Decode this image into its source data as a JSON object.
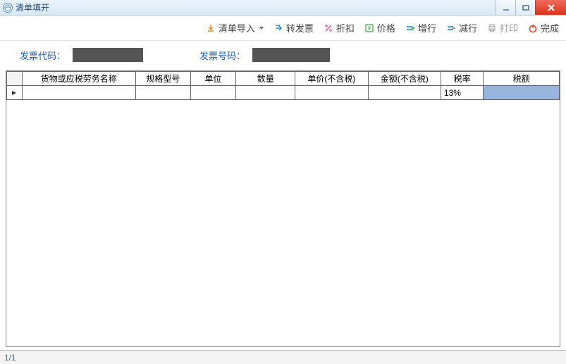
{
  "window": {
    "title": "清单填开"
  },
  "toolbar": {
    "import": "清单导入",
    "to_invoice": "转发票",
    "discount": "折扣",
    "price": "价格",
    "add_row": "增行",
    "del_row": "减行",
    "print": "打印",
    "finish": "完成"
  },
  "info": {
    "code_label": "发票代码：",
    "num_label": "发票号码："
  },
  "grid": {
    "headers": {
      "name": "货物或应税劳务名称",
      "spec": "规格型号",
      "unit": "单位",
      "qty": "数量",
      "price": "单价(不含税)",
      "amount": "金额(不含税)",
      "rate": "税率",
      "tax": "税额"
    },
    "rows": [
      {
        "name": "",
        "spec": "",
        "unit": "",
        "qty": "",
        "price": "",
        "amount": "",
        "rate": "13%",
        "tax": ""
      }
    ]
  },
  "status": {
    "page": "1/1"
  }
}
